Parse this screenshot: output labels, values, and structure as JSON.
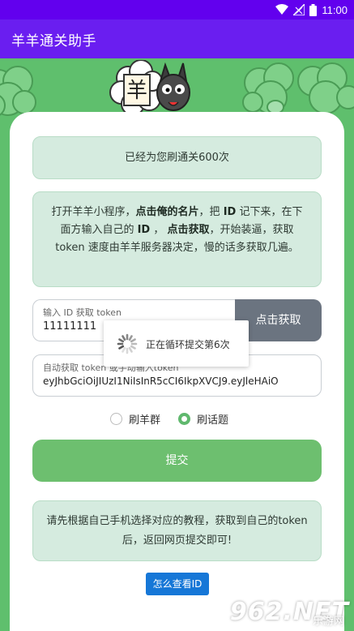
{
  "status_bar": {
    "time": "11:00"
  },
  "app_bar": {
    "title": "羊羊通关助手"
  },
  "count_box": {
    "text": "已经为您刷通关600次"
  },
  "instructions": {
    "t1": "打开羊羊小程序，",
    "b1": "点击俺的名片",
    "t2": "，把 ",
    "b2": "ID",
    "t3": " 记下来，在下面方输入自己的 ",
    "b3": "ID",
    "t4": " ， ",
    "b4": "点击获取",
    "t5": "，开始装逼，获取 token 速度由羊羊服务器决定，慢的话多获取几遍。"
  },
  "id_input": {
    "label": "输入 ID 获取 token",
    "value": "11111111"
  },
  "fetch_button": {
    "label": "点击获取"
  },
  "token_input": {
    "label": "自动获取 token 或手动输入token",
    "value": "eyJhbGciOiJIUzI1NiIsInR5cCI6IkpXVCJ9.eyJleHAiO"
  },
  "radios": [
    {
      "label": "刷羊群",
      "selected": false
    },
    {
      "label": "刷话题",
      "selected": true
    }
  ],
  "submit_button": {
    "label": "提交"
  },
  "tip_box": {
    "text": "请先根据自己手机选择对应的教程，获取到自己的token后，返回网页提交即可!"
  },
  "howto_button": {
    "label": "怎么查看ID"
  },
  "toast": {
    "text": "正在循环提交第6次"
  },
  "mascot": {
    "char": "羊"
  },
  "watermark": {
    "big": "962.NET",
    "small": "乐游网"
  },
  "colors": {
    "status_bar": "#6200ee",
    "app_bar": "#6a1ef0",
    "background": "#5fbf6d",
    "submit": "#6dbf6f",
    "fetch": "#6b7480",
    "link": "#1677d7"
  },
  "icons": [
    "wifi-icon",
    "signal-icon",
    "battery-icon",
    "spinner-icon",
    "sheep-illustration"
  ]
}
